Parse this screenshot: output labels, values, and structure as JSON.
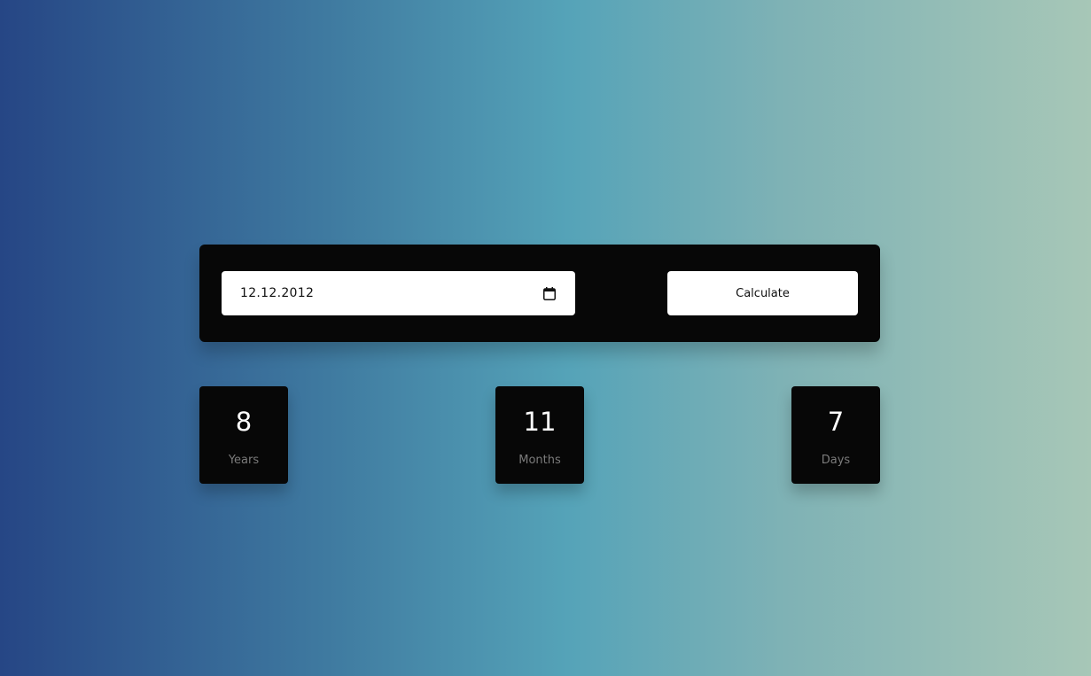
{
  "form": {
    "date_value": "12.12.2012",
    "calculate_label": "Calculate"
  },
  "results": {
    "years": {
      "value": "8",
      "label": "Years"
    },
    "months": {
      "value": "11",
      "label": "Months"
    },
    "days": {
      "value": "7",
      "label": "Days"
    }
  },
  "icons": {
    "calendar": "calendar-icon"
  },
  "colors": {
    "card_background": "#070707",
    "button_background": "#ffffff",
    "gradient_start": "#264685",
    "gradient_end": "#a7c7b7",
    "label_color": "#7b7b7b"
  }
}
